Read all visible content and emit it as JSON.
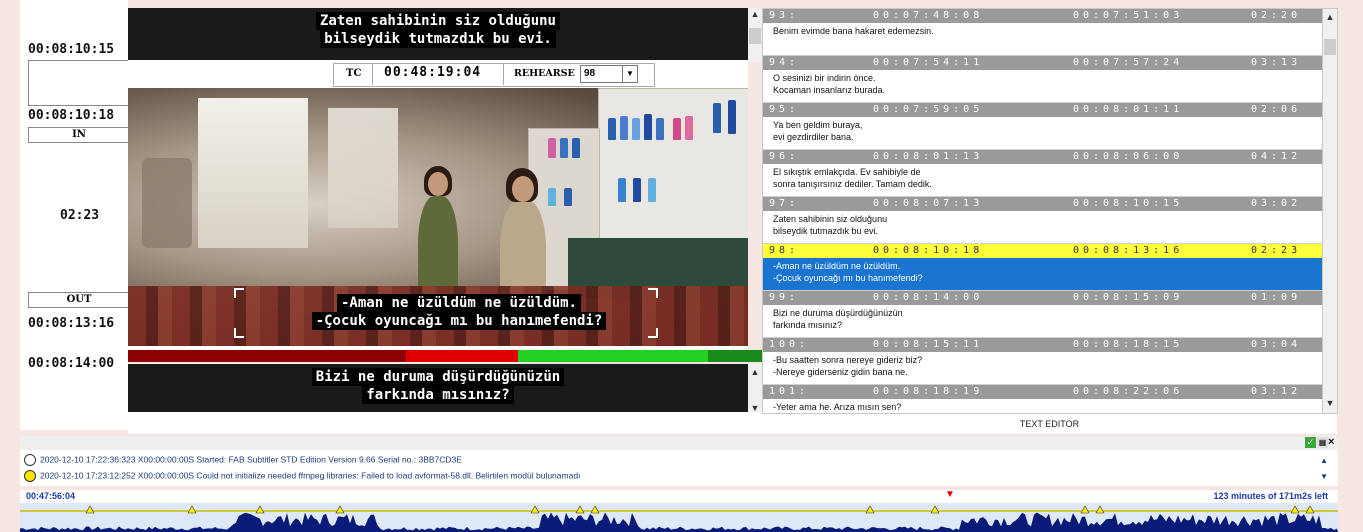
{
  "left_panel": {
    "tc_top": "00:08:10:15",
    "tc_in_value": "00:08:10:18",
    "in_label": "IN",
    "duration": "02:23",
    "out_label": "OUT",
    "tc_out_value": "00:08:13:16",
    "tc_next": "00:08:14:00"
  },
  "subtitle_prev": {
    "line1": "Zaten sahibinin siz olduğunu",
    "line2": "bilseydik tutmazdık bu evi."
  },
  "toolbar": {
    "tc_label": "TC",
    "tc_value": "00:48:19:04",
    "rehearse_label": "REHEARSE",
    "rehearse_value": "98"
  },
  "video": {
    "subtitle_line1": "-Aman ne üzüldüm ne üzüldüm.",
    "subtitle_line2": "-Çocuk oyuncağı mı bu hanımefendi?"
  },
  "subtitle_next": {
    "line1": "Bizi ne duruma düşürdüğünüzün",
    "line2": "farkında mısınız?"
  },
  "subtitle_list": [
    {
      "num": "93:",
      "in": "00:07:48:08",
      "out": "00:07:51:03",
      "dur": "02:20",
      "text1": "Benim evimde bana hakaret edemezsin.",
      "text2": ""
    },
    {
      "num": "94:",
      "in": "00:07:54:11",
      "out": "00:07:57:24",
      "dur": "03:13",
      "text1": "O sesinizi bir indirin önce.",
      "text2": "Kocaman insanlarız burada."
    },
    {
      "num": "95:",
      "in": "00:07:59:05",
      "out": "00:08:01:11",
      "dur": "02:06",
      "text1": "Ya ben geldim buraya,",
      "text2": "evi gezdirdiler bana."
    },
    {
      "num": "96:",
      "in": "00:08:01:13",
      "out": "00:08:06:00",
      "dur": "04:12",
      "text1": "El sıkıştık emlakçıda. Ev sahibiyle de",
      "text2": "sonra tanışırsınız dediler. Tamam dedik."
    },
    {
      "num": "97:",
      "in": "00:08:07:13",
      "out": "00:08:10:15",
      "dur": "03:02",
      "text1": "Zaten sahibinin siz olduğunu",
      "text2": "bilseydik tutmazdık bu evi."
    },
    {
      "num": "98:",
      "in": "00:08:10:18",
      "out": "00:08:13:16",
      "dur": "02:23",
      "text1": "-Aman ne üzüldüm ne üzüldüm.",
      "text2": "-Çocuk oyuncağı mı bu hanımefendi?"
    },
    {
      "num": "99:",
      "in": "00:08:14:00",
      "out": "00:08:15:09",
      "dur": "01:09",
      "text1": "Bizi ne duruma düşürdüğünüzün",
      "text2": "farkında mısınız?"
    },
    {
      "num": "100:",
      "in": "00:08:15:11",
      "out": "00:08:18:15",
      "dur": "03:04",
      "text1": "-Bu saatten sonra nereye gideriz biz?",
      "text2": "-Nereye giderseniz gidin bana ne."
    },
    {
      "num": "101:",
      "in": "00:08:18:19",
      "out": "00:08:22:06",
      "dur": "03:12",
      "text1": "-Yeter ama he. Arıza mısın sen?",
      "text2": ""
    }
  ],
  "text_editor_label": "TEXT EDITOR",
  "log": [
    {
      "text": "2020-12-10   17:22:36:323   X00:00:00:00S  Started: FAB Subtitler STD Edition Version 9.66 Serial no.: 3BB7CD3E",
      "color": "#ffffff"
    },
    {
      "text": "2020-12-10   17:23:12:252   X00:00:00:00S  Could not initialize needed ffmpeg libraries: Failed to load avformat-58.dll. Belirtilen modül bulunamadı",
      "color": "#ffe600"
    }
  ],
  "waveform": {
    "time_label": "00:47:56:04",
    "remaining": "123 minutes of 171m2s left"
  },
  "progress_bar": {
    "colors": [
      "#8b0000",
      "#e00000",
      "#22d022",
      "#1a8a1a"
    ]
  }
}
